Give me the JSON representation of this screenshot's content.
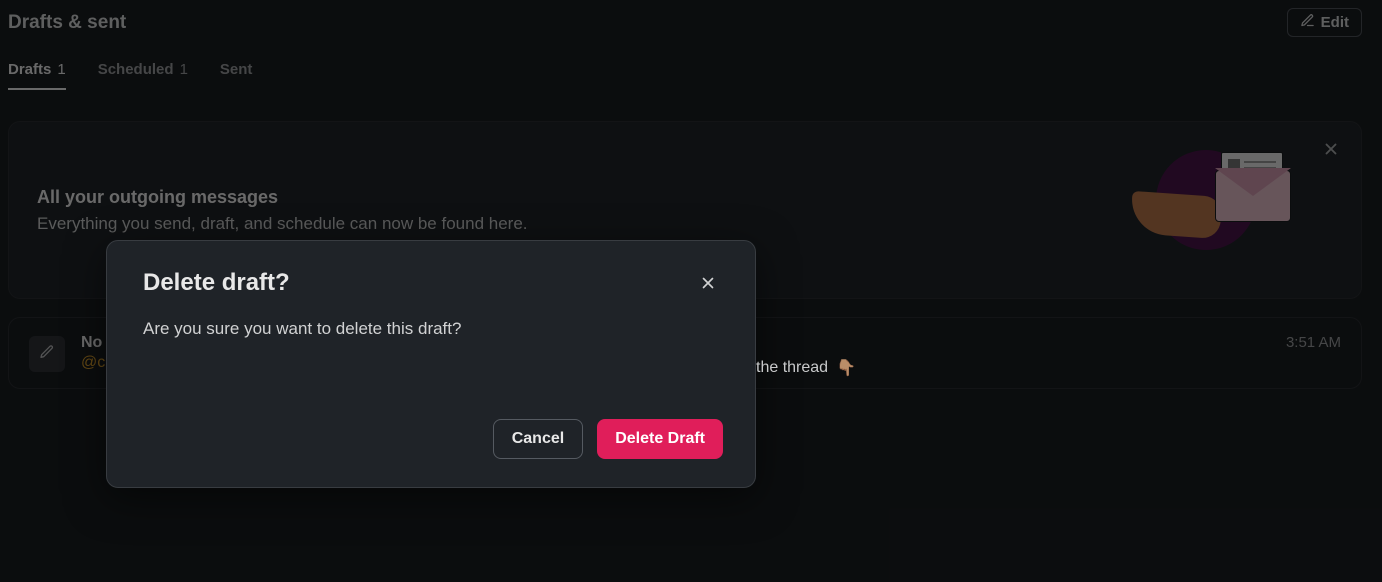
{
  "header": {
    "title": "Drafts & sent",
    "edit_label": "Edit"
  },
  "tabs": [
    {
      "label": "Drafts",
      "count": "1",
      "active": true
    },
    {
      "label": "Scheduled",
      "count": "1",
      "active": false
    },
    {
      "label": "Sent",
      "count": "",
      "active": false
    }
  ],
  "banner": {
    "title": "All your outgoing messages",
    "subtitle": "Everything you send, draft, and schedule can now be found here."
  },
  "draft": {
    "title_prefix": "No",
    "mention": "@cl",
    "snippet_tail": "the thread",
    "emoji": "👇🏽",
    "time": "3:51 AM"
  },
  "modal": {
    "title": "Delete draft?",
    "body": "Are you sure you want to delete this draft?",
    "cancel": "Cancel",
    "confirm": "Delete Draft"
  }
}
